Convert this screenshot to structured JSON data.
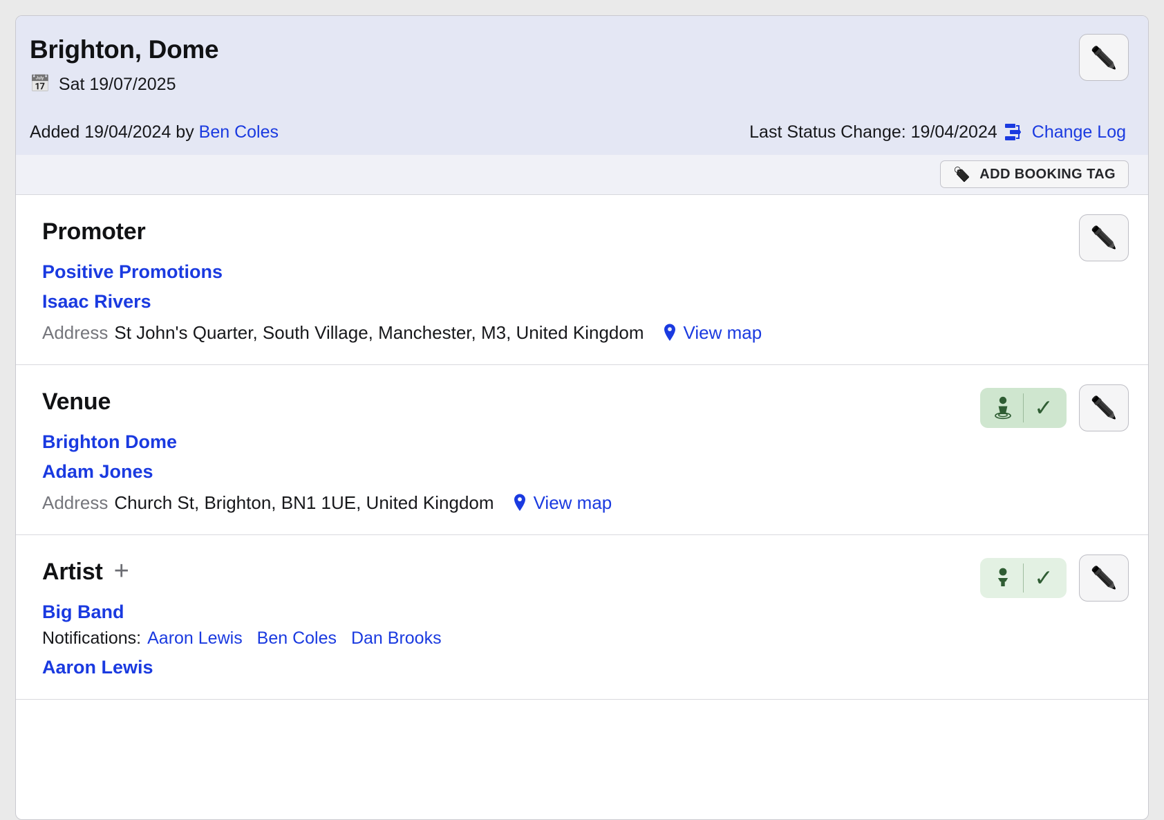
{
  "header": {
    "title": "Brighton, Dome",
    "calendar_icon": "calendar-icon",
    "date": "Sat 19/07/2025",
    "added_text": "Added 19/04/2024 by ",
    "added_by": "Ben Coles",
    "last_status_change": "Last Status Change: 19/04/2024",
    "changelog_icon": "change-log-icon",
    "changelog_label": "Change Log",
    "edit_icon": "✏️"
  },
  "tagbar": {
    "tag_icon": "🏷️",
    "add_booking_tag_label": "ADD BOOKING TAG"
  },
  "promoter": {
    "title": "Promoter",
    "company": "Positive Promotions",
    "contact": "Isaac Rivers",
    "address_label": "Address",
    "address": "St John's Quarter, South Village, Manchester, M3, United Kingdom",
    "view_map_label": "View map",
    "pin_icon": "map-pin-icon",
    "edit_icon": "✏️"
  },
  "venue": {
    "title": "Venue",
    "name": "Brighton Dome",
    "contact": "Adam Jones",
    "address_label": "Address",
    "address": "Church St, Brighton, BN1 1UE, United Kingdom",
    "view_map_label": "View map",
    "pin_icon": "map-pin-icon",
    "status_icon": "venue-confirmed-icon",
    "check_icon": "✓",
    "edit_icon": "✏️"
  },
  "artist": {
    "title": "Artist",
    "add_icon": "+",
    "name": "Big Band",
    "notifications_label": "Notifications:",
    "notifications": [
      "Aaron Lewis",
      "Ben Coles",
      "Dan Brooks"
    ],
    "agent": "Aaron Lewis",
    "status_icon": "artist-confirmed-icon",
    "check_icon": "✓",
    "edit_icon": "✏️"
  },
  "colors": {
    "header_bg": "#e4e7f4",
    "tagbar_bg": "#f0f1f7",
    "link": "#1a3ae0",
    "venue_pill_bg": "#cfe6cf",
    "artist_pill_bg": "#e3f1e3",
    "status_green": "#2f5d33"
  }
}
